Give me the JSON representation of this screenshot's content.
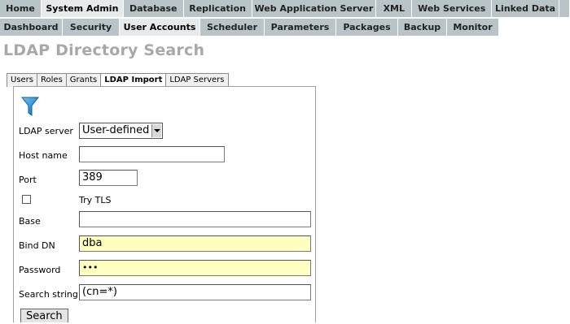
{
  "top_nav": {
    "row1": [
      {
        "label": "Home",
        "active": false
      },
      {
        "label": "System Admin",
        "active": true
      },
      {
        "label": "Database",
        "active": false
      },
      {
        "label": "Replication",
        "active": false
      },
      {
        "label": "Web Application Server",
        "active": false
      },
      {
        "label": "XML",
        "active": false
      },
      {
        "label": "Web Services",
        "active": false
      },
      {
        "label": "Linked Data",
        "active": false
      }
    ],
    "row2": [
      {
        "label": "Dashboard",
        "active": false
      },
      {
        "label": "Security",
        "active": false
      },
      {
        "label": "User Accounts",
        "active": true
      },
      {
        "label": "Scheduler",
        "active": false
      },
      {
        "label": "Parameters",
        "active": false
      },
      {
        "label": "Packages",
        "active": false
      },
      {
        "label": "Backup",
        "active": false
      },
      {
        "label": "Monitor",
        "active": false
      }
    ]
  },
  "page_title": "LDAP Directory Search",
  "sub_tabs": [
    {
      "label": "Users",
      "active": false
    },
    {
      "label": "Roles",
      "active": false
    },
    {
      "label": "Grants",
      "active": false
    },
    {
      "label": "LDAP Import",
      "active": true
    },
    {
      "label": "LDAP Servers",
      "active": false
    }
  ],
  "form": {
    "filter_icon": "funnel-icon",
    "ldap_server": {
      "label": "LDAP server",
      "value": "User-defined"
    },
    "host_name": {
      "label": "Host name",
      "value": ""
    },
    "port": {
      "label": "Port",
      "value": "389"
    },
    "try_tls": {
      "label": "Try TLS",
      "checked": false
    },
    "base": {
      "label": "Base",
      "value": ""
    },
    "bind_dn": {
      "label": "Bind DN",
      "value": "dba"
    },
    "password": {
      "label": "Password",
      "value": "•••"
    },
    "search_string": {
      "label": "Search string",
      "value": "(cn=*)"
    },
    "search_button": "Search"
  },
  "colors": {
    "nav_tab": "#b9c4c8",
    "nav_active": "#e7eaeb",
    "title_gray": "#a8a8a8",
    "autofill_yellow": "#ffffc0"
  }
}
